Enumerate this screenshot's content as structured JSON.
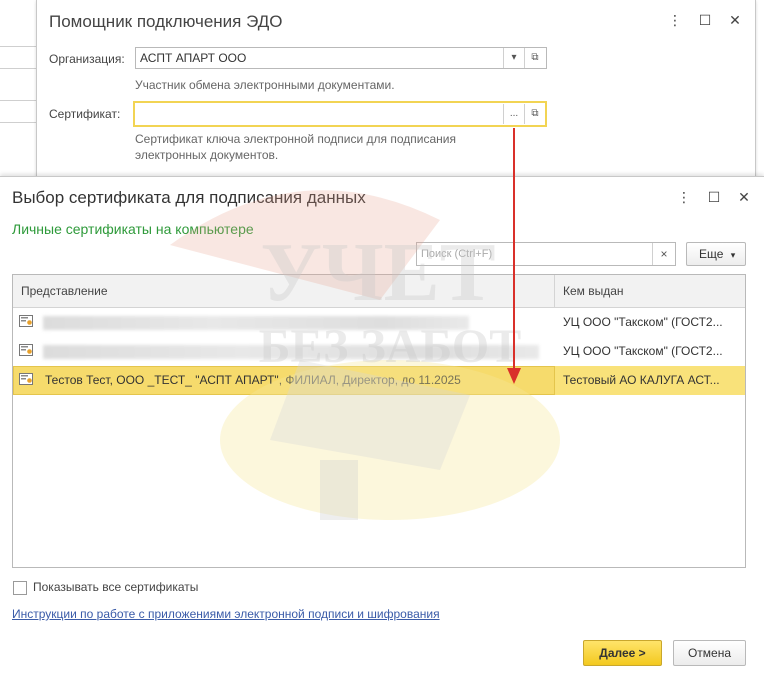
{
  "back_window": {
    "title": "Помощник подключения ЭДО",
    "org_label": "Организация:",
    "org_value": "АСПТ АПАРТ ООО",
    "org_hint": "Участник обмена электронными документами.",
    "cert_label": "Сертификат:",
    "cert_value": "",
    "cert_btn": "...",
    "cert_hint_1": "Сертификат ключа электронной подписи для подписания",
    "cert_hint_2": "электронных документов."
  },
  "dialog": {
    "title": "Выбор сертификата для подписания данных",
    "subtitle": "Личные сертификаты на компьютере",
    "search_placeholder": "Поиск (Ctrl+F)",
    "more_button": "Еще",
    "columns": [
      "Представление",
      "Кем выдан"
    ],
    "rows": [
      {
        "name": "",
        "issuer": "УЦ ООО \"Такском\" (ГОСТ2...",
        "selected": false
      },
      {
        "name": "",
        "issuer": "УЦ ООО \"Такском\" (ГОСТ2...",
        "selected": false
      },
      {
        "name": "Тестов Тест, ООО _ТЕСТ_ \"АСПТ АПАРТ\", ФИЛИАЛ, Директор, до 11.2025",
        "issuer": "Тестовый АО КАЛУГА АСТ...",
        "selected": true
      }
    ],
    "show_all_label": "Показывать все сертификаты",
    "instructions_link": "Инструкции по работе с приложениями электронной подписи и шифрования",
    "next_button": "Далее >",
    "cancel_button": "Отмена"
  },
  "watermark": {
    "line1": "УЧЕТ",
    "line2": "БЕЗ ЗАБОТ"
  },
  "colors": {
    "accent_yellow": "#f3c91f",
    "selection": "#f9e27a",
    "subtitle_green": "#2e9a3a",
    "link_blue": "#3a5ba8",
    "arrow_red": "#d9302a"
  }
}
